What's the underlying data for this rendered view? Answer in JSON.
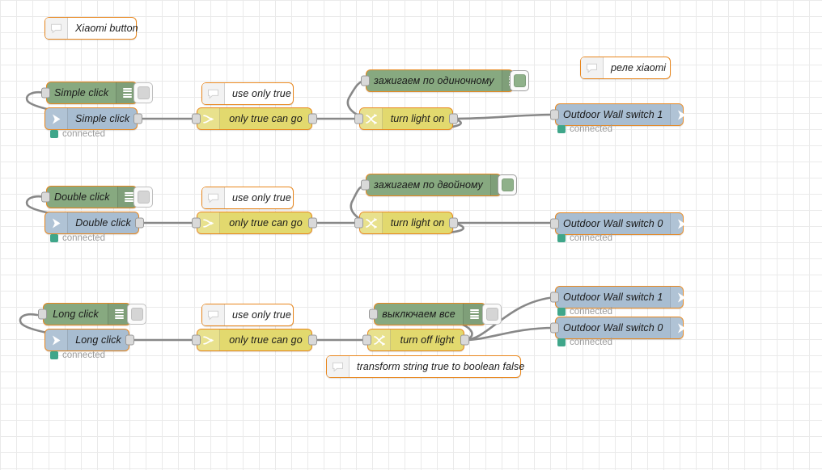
{
  "app": {
    "name": "Node-RED flow editor",
    "canvas_label": "flow-canvas"
  },
  "palette": {
    "green": "#87a980",
    "yellow": "#e2d96e",
    "blue": "#a8bdd1",
    "white": "#ffffff",
    "selected_border": "#e8871e",
    "wire": "#888888",
    "status_green": "#3fa68a",
    "status_text": "#9b9b9b",
    "grid_line": "#eaeaea"
  },
  "status_labels": {
    "connected": "connected"
  },
  "comments": [
    {
      "id": "cmt-xiaomi-button",
      "label": "Xiaomi button",
      "icon": "comment-icon"
    },
    {
      "id": "cmt-use-only-true-1",
      "label": "use only true",
      "icon": "comment-icon"
    },
    {
      "id": "cmt-use-only-true-2",
      "label": "use only true",
      "icon": "comment-icon"
    },
    {
      "id": "cmt-use-only-true-3",
      "label": "use only true",
      "icon": "comment-icon"
    },
    {
      "id": "cmt-rele-xiaomi",
      "label": "реле xiaomi",
      "icon": "comment-icon"
    },
    {
      "id": "cmt-transform",
      "label": "transform string true to boolean false",
      "icon": "comment-icon"
    }
  ],
  "rows": [
    {
      "id": "row-simple-click",
      "trigger": {
        "label": "Simple click",
        "icon": "list-icon",
        "button_state": "inactive"
      },
      "source": {
        "label": "Simple click",
        "icon": "arrow-right-icon",
        "status": "connected"
      },
      "switch": {
        "label": "only true can go",
        "icon": "switch-icon"
      },
      "debug": {
        "label": "зажигаем по одиночному",
        "icon": "list-icon",
        "button_state": "active"
      },
      "change": {
        "label": "turn light on",
        "icon": "change-icon"
      },
      "outputs": [
        {
          "label": "Outdoor Wall switch 1",
          "icon": "arrow-right-icon",
          "status": "connected"
        }
      ]
    },
    {
      "id": "row-double-click",
      "trigger": {
        "label": "Double click",
        "icon": "list-icon",
        "button_state": "inactive"
      },
      "source": {
        "label": "Double click",
        "icon": "arrow-right-icon",
        "status": "connected"
      },
      "switch": {
        "label": "only true can go",
        "icon": "switch-icon"
      },
      "debug": {
        "label": "зажигаем по двойному",
        "icon": "list-icon",
        "button_state": "active"
      },
      "change": {
        "label": "turn light on",
        "icon": "change-icon"
      },
      "outputs": [
        {
          "label": "Outdoor Wall switch 0",
          "icon": "arrow-right-icon",
          "status": "connected"
        }
      ]
    },
    {
      "id": "row-long-click",
      "trigger": {
        "label": "Long click",
        "icon": "list-icon",
        "button_state": "inactive"
      },
      "source": {
        "label": "Long click",
        "icon": "arrow-right-icon",
        "status": "connected"
      },
      "switch": {
        "label": "only true can go",
        "icon": "switch-icon"
      },
      "debug": {
        "label": "выключаем все",
        "icon": "list-icon",
        "button_state": "inactive"
      },
      "change": {
        "label": "turn off light",
        "icon": "change-icon"
      },
      "outputs": [
        {
          "label": "Outdoor Wall switch 1",
          "icon": "arrow-right-icon",
          "status": "connected"
        },
        {
          "label": "Outdoor Wall switch 0",
          "icon": "arrow-right-icon",
          "status": "connected"
        }
      ]
    }
  ]
}
